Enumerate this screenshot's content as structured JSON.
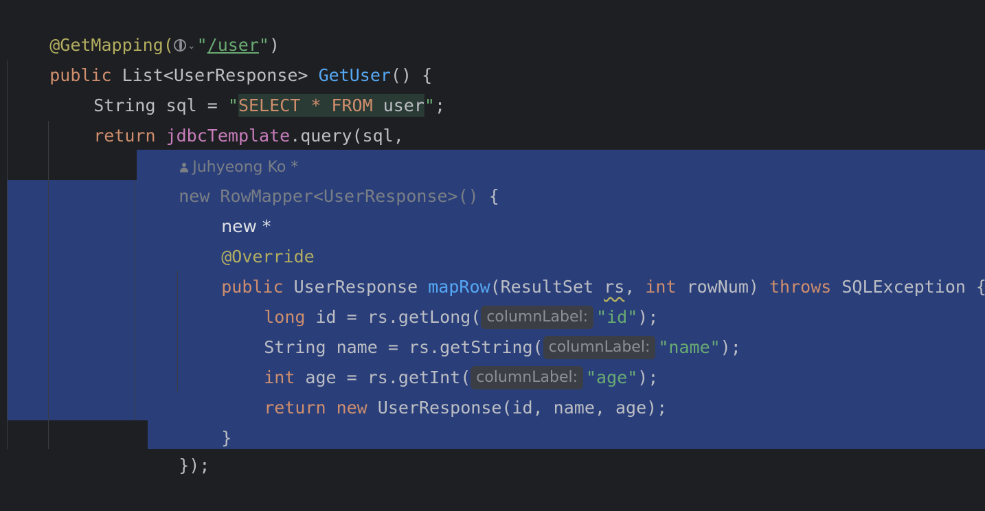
{
  "code": {
    "l1": {
      "annotation": "@GetMapping(",
      "url": "/user",
      "quote_open": "\"",
      "quote_close": "\"",
      "close": ")"
    },
    "l2": {
      "kw_public": "public",
      "type": " List<UserResponse> ",
      "fn": "GetUser",
      "rest": "() {"
    },
    "l3": {
      "type": "String sql = ",
      "str_open": "\"",
      "sql_select": "SELECT",
      "sql_star": " * ",
      "sql_from": "FROM",
      "sql_table": " user",
      "str_close": "\"",
      "semi": ";"
    },
    "l4": {
      "kw_return": "return",
      "field": " jdbcTemplate",
      "rest": ".query(sql,"
    },
    "l5": {
      "author": "Juhyeong Ko *"
    },
    "l6": {
      "kw_new": "new",
      "type": " RowMapper<UserResponse>()",
      "brace": " {"
    },
    "l7": {
      "text": "new *"
    },
    "l8": {
      "annotation": "@Override"
    },
    "l9": {
      "kw_public": "public",
      "type": " UserResponse ",
      "fn": "mapRow",
      "p1": "(ResultSet ",
      "rs": "rs",
      "p2": ", ",
      "kw_int": "int",
      "p3": " rowNum) ",
      "kw_throws": "throws",
      "p4": " SQLException {"
    },
    "l10": {
      "kw_long": "long",
      "p1": " id = rs.getLong(",
      "hint": "columnLabel:",
      "str": "\"id\"",
      "end": ");"
    },
    "l11": {
      "p0": "String name = rs.getString(",
      "hint": "columnLabel:",
      "str": "\"name\"",
      "end": ");"
    },
    "l12": {
      "kw_int": "int",
      "p1": " age = rs.getInt(",
      "hint": "columnLabel:",
      "str": "\"age\"",
      "end": ");"
    },
    "l13": {
      "kw_return": "return",
      "kw_new": " new",
      "rest": " UserResponse(id, name, age);"
    },
    "l14": {
      "brace": "}"
    },
    "l15": {
      "text": "});"
    }
  },
  "colors": {
    "background": "#1e1f22",
    "selection": "#2a3f7a",
    "keyword": "#cf8e6d",
    "annotation": "#b3ae60",
    "function": "#56a8f5",
    "string": "#6aab73",
    "field": "#c77dbb"
  },
  "icons": [
    "globe-icon",
    "chevron-down-icon",
    "user-icon"
  ]
}
